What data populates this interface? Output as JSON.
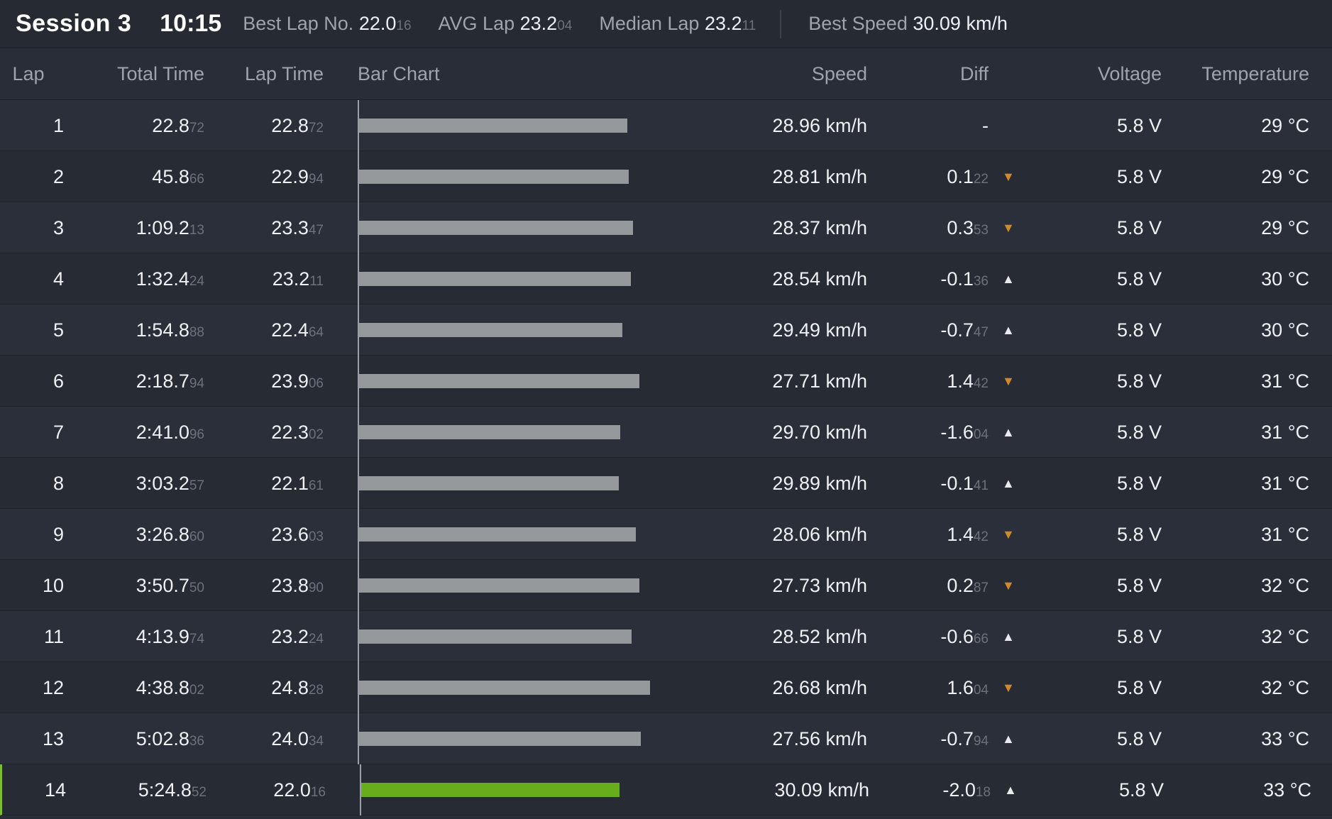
{
  "header": {
    "session": "Session 3",
    "time": "10:15",
    "best_lap": {
      "label": "Best Lap No.",
      "value": "22.0",
      "ms": "16"
    },
    "avg_lap": {
      "label": "AVG Lap",
      "value": "23.2",
      "ms": "04"
    },
    "median_lap": {
      "label": "Median Lap",
      "value": "23.2",
      "ms": "11"
    },
    "best_speed": {
      "label": "Best Speed",
      "value": "30.09 km/h"
    }
  },
  "columns": {
    "lap": "Lap",
    "total_time": "Total Time",
    "lap_time": "Lap Time",
    "bar_chart": "Bar Chart",
    "speed": "Speed",
    "diff": "Diff",
    "voltage": "Voltage",
    "temperature": "Temperature"
  },
  "colors": {
    "bar": "#96999b",
    "best_bar": "#67ad1c",
    "slower_arrow": "#d08a2a",
    "faster_arrow": "#e8eaee"
  },
  "rows": [
    {
      "lap": "1",
      "total": "22.8",
      "total_ms": "72",
      "laptime": "22.8",
      "laptime_ms": "72",
      "seconds": 22.872,
      "speed": "28.96 km/h",
      "diff": "-",
      "diff_ms": "",
      "trend": "none",
      "voltage": "5.8 V",
      "temperature": "29 °C"
    },
    {
      "lap": "2",
      "total": "45.8",
      "total_ms": "66",
      "laptime": "22.9",
      "laptime_ms": "94",
      "seconds": 22.994,
      "speed": "28.81 km/h",
      "diff": "0.1",
      "diff_ms": "22",
      "trend": "down",
      "voltage": "5.8 V",
      "temperature": "29 °C"
    },
    {
      "lap": "3",
      "total": "1:09.2",
      "total_ms": "13",
      "laptime": "23.3",
      "laptime_ms": "47",
      "seconds": 23.347,
      "speed": "28.37 km/h",
      "diff": "0.3",
      "diff_ms": "53",
      "trend": "down",
      "voltage": "5.8 V",
      "temperature": "29 °C"
    },
    {
      "lap": "4",
      "total": "1:32.4",
      "total_ms": "24",
      "laptime": "23.2",
      "laptime_ms": "11",
      "seconds": 23.211,
      "speed": "28.54 km/h",
      "diff": "-0.1",
      "diff_ms": "36",
      "trend": "up",
      "voltage": "5.8 V",
      "temperature": "30 °C"
    },
    {
      "lap": "5",
      "total": "1:54.8",
      "total_ms": "88",
      "laptime": "22.4",
      "laptime_ms": "64",
      "seconds": 22.464,
      "speed": "29.49 km/h",
      "diff": "-0.7",
      "diff_ms": "47",
      "trend": "up",
      "voltage": "5.8 V",
      "temperature": "30 °C"
    },
    {
      "lap": "6",
      "total": "2:18.7",
      "total_ms": "94",
      "laptime": "23.9",
      "laptime_ms": "06",
      "seconds": 23.906,
      "speed": "27.71 km/h",
      "diff": "1.4",
      "diff_ms": "42",
      "trend": "down",
      "voltage": "5.8 V",
      "temperature": "31 °C"
    },
    {
      "lap": "7",
      "total": "2:41.0",
      "total_ms": "96",
      "laptime": "22.3",
      "laptime_ms": "02",
      "seconds": 22.302,
      "speed": "29.70 km/h",
      "diff": "-1.6",
      "diff_ms": "04",
      "trend": "up",
      "voltage": "5.8 V",
      "temperature": "31 °C"
    },
    {
      "lap": "8",
      "total": "3:03.2",
      "total_ms": "57",
      "laptime": "22.1",
      "laptime_ms": "61",
      "seconds": 22.161,
      "speed": "29.89 km/h",
      "diff": "-0.1",
      "diff_ms": "41",
      "trend": "up",
      "voltage": "5.8 V",
      "temperature": "31 °C"
    },
    {
      "lap": "9",
      "total": "3:26.8",
      "total_ms": "60",
      "laptime": "23.6",
      "laptime_ms": "03",
      "seconds": 23.603,
      "speed": "28.06 km/h",
      "diff": "1.4",
      "diff_ms": "42",
      "trend": "down",
      "voltage": "5.8 V",
      "temperature": "31 °C"
    },
    {
      "lap": "10",
      "total": "3:50.7",
      "total_ms": "50",
      "laptime": "23.8",
      "laptime_ms": "90",
      "seconds": 23.89,
      "speed": "27.73 km/h",
      "diff": "0.2",
      "diff_ms": "87",
      "trend": "down",
      "voltage": "5.8 V",
      "temperature": "32 °C"
    },
    {
      "lap": "11",
      "total": "4:13.9",
      "total_ms": "74",
      "laptime": "23.2",
      "laptime_ms": "24",
      "seconds": 23.224,
      "speed": "28.52 km/h",
      "diff": "-0.6",
      "diff_ms": "66",
      "trend": "up",
      "voltage": "5.8 V",
      "temperature": "32 °C"
    },
    {
      "lap": "12",
      "total": "4:38.8",
      "total_ms": "02",
      "laptime": "24.8",
      "laptime_ms": "28",
      "seconds": 24.828,
      "speed": "26.68 km/h",
      "diff": "1.6",
      "diff_ms": "04",
      "trend": "down",
      "voltage": "5.8 V",
      "temperature": "32 °C"
    },
    {
      "lap": "13",
      "total": "5:02.8",
      "total_ms": "36",
      "laptime": "24.0",
      "laptime_ms": "34",
      "seconds": 24.034,
      "speed": "27.56 km/h",
      "diff": "-0.7",
      "diff_ms": "94",
      "trend": "up",
      "voltage": "5.8 V",
      "temperature": "33 °C"
    },
    {
      "lap": "14",
      "total": "5:24.8",
      "total_ms": "52",
      "laptime": "22.0",
      "laptime_ms": "16",
      "seconds": 22.016,
      "speed": "30.09 km/h",
      "diff": "-2.0",
      "diff_ms": "18",
      "trend": "up",
      "voltage": "5.8 V",
      "temperature": "33 °C",
      "best": true
    }
  ]
}
